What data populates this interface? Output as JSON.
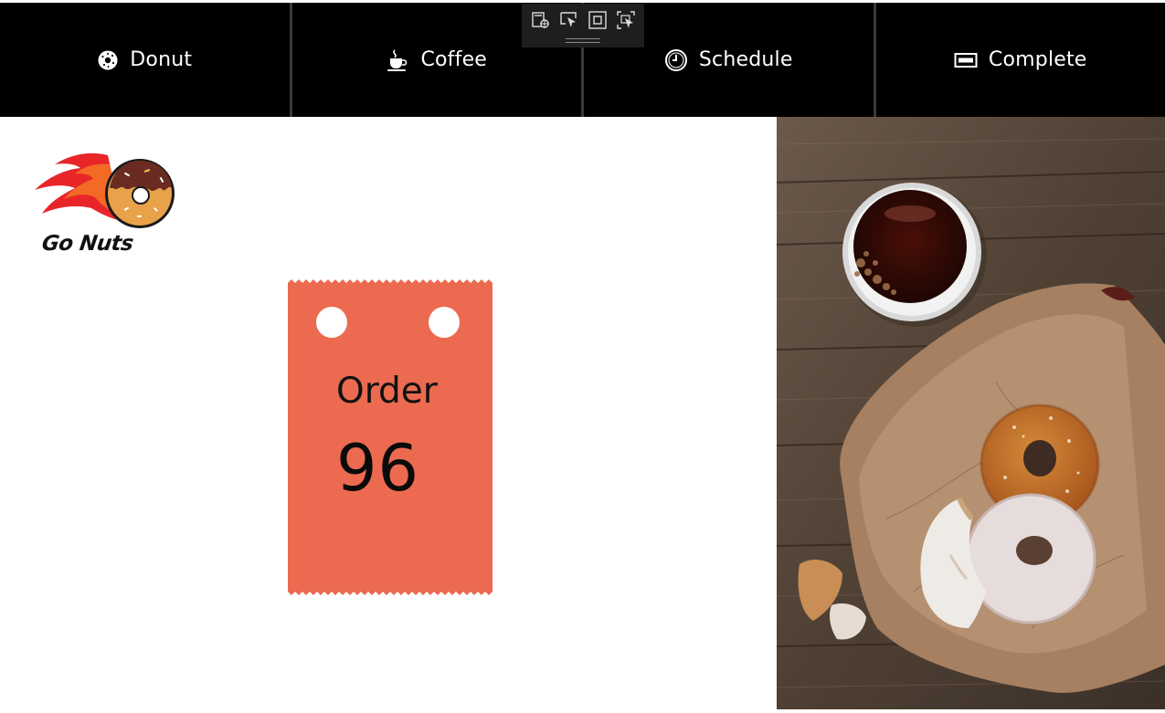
{
  "nav": {
    "items": [
      {
        "label": "Donut",
        "icon": "donut-icon"
      },
      {
        "label": "Coffee",
        "icon": "coffee-cup-icon"
      },
      {
        "label": "Schedule",
        "icon": "clock-icon"
      },
      {
        "label": "Complete",
        "icon": "ticket-icon"
      }
    ]
  },
  "devbar": {
    "icons": [
      "select-element-icon",
      "select-pointer-icon",
      "highlight-box-icon",
      "layout-adorner-icon"
    ]
  },
  "logo": {
    "text": "Go Nuts",
    "icon": "flaming-donut-logo"
  },
  "ticket": {
    "label": "Order",
    "number": "96",
    "color": "#ec6a50"
  },
  "photo": {
    "subject": "coffee-and-donuts-photo"
  },
  "colors": {
    "nav_bg": "#000000",
    "nav_text": "#ffffff",
    "ticket": "#ec6a50",
    "wood": "#5a4a3e",
    "paper_bag": "#b08a68"
  }
}
